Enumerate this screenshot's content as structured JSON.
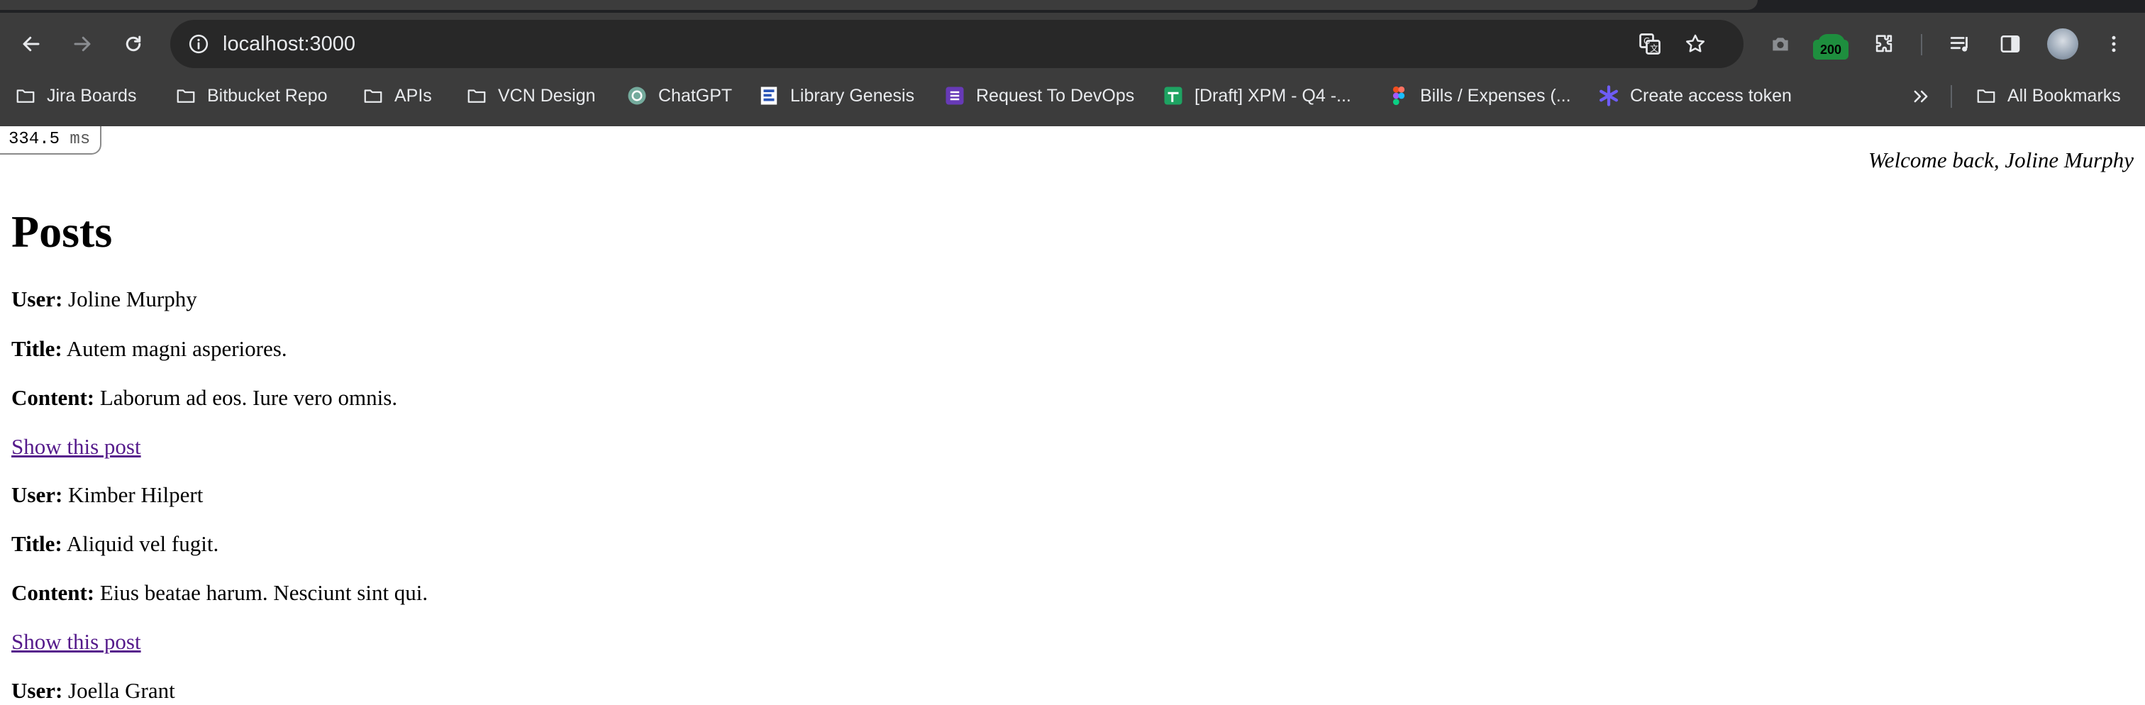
{
  "browser": {
    "url": "localhost:3000",
    "extension_badge": "200",
    "bookmarks": [
      {
        "label": "Jira Boards",
        "icon": "folder-icon"
      },
      {
        "label": "Bitbucket Repo",
        "icon": "folder-icon"
      },
      {
        "label": "APIs",
        "icon": "folder-icon"
      },
      {
        "label": "VCN Design",
        "icon": "folder-icon"
      },
      {
        "label": "ChatGPT",
        "icon": "chatgpt-icon"
      },
      {
        "label": "Library Genesis",
        "icon": "library-genesis-icon"
      },
      {
        "label": "Request To DevOps",
        "icon": "list-form-icon"
      },
      {
        "label": "[Draft] XPM - Q4 -...",
        "icon": "sheets-icon"
      },
      {
        "label": "Bills / Expenses (...",
        "icon": "figma-icon"
      },
      {
        "label": "Create access token",
        "icon": "asterisk-icon"
      }
    ],
    "all_bookmarks_label": "All Bookmarks"
  },
  "timer": {
    "value": "334.5",
    "unit": "ms"
  },
  "welcome": "Welcome back, Joline Murphy",
  "page_title": "Posts",
  "labels": {
    "user": "User:",
    "title": "Title:",
    "content": "Content:",
    "show_link": "Show this post"
  },
  "posts": [
    {
      "user": "Joline Murphy",
      "title": "Autem magni asperiores.",
      "content": "Laborum ad eos. Iure vero omnis."
    },
    {
      "user": "Kimber Hilpert",
      "title": "Aliquid vel fugit.",
      "content": "Eius beatae harum. Nesciunt sint qui."
    },
    {
      "user": "Joella Grant"
    }
  ],
  "colors": {
    "chrome_bg": "#3c3c3c",
    "omnibox_bg": "#282828",
    "link_visited": "#551a8b",
    "badge_green": "#1e8e3e"
  }
}
